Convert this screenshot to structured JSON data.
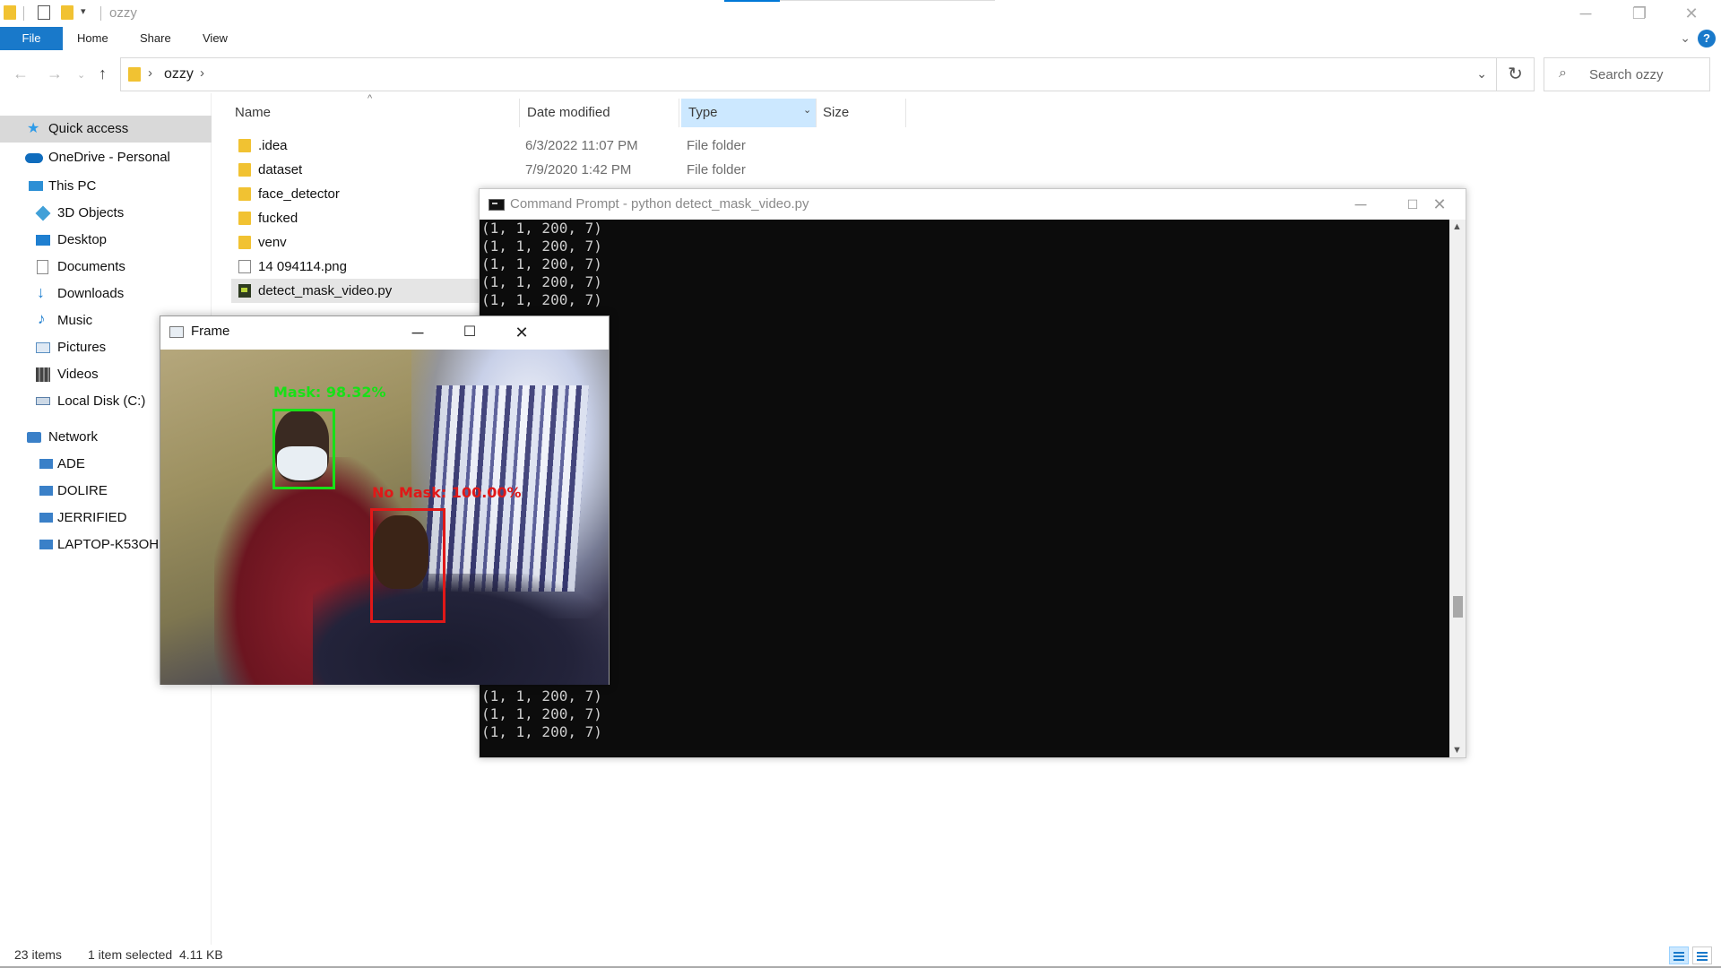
{
  "window": {
    "title": "ozzy",
    "minimize": "─",
    "maximize": "❐",
    "close": "✕"
  },
  "ribbon": {
    "tabs": [
      "File",
      "Home",
      "Share",
      "View"
    ],
    "help": "?"
  },
  "address": {
    "crumb": "ozzy",
    "search_placeholder": "Search ozzy"
  },
  "nav": {
    "items": [
      {
        "label": "Quick access",
        "icon": "star-icon",
        "color": "#2e9be8"
      },
      {
        "label": "OneDrive - Personal",
        "icon": "cloud-icon",
        "color": "#0f6cbd"
      },
      {
        "label": "This PC",
        "icon": "pc-icon",
        "color": "#2d8fd5"
      },
      {
        "label": "3D Objects",
        "icon": "cube-icon",
        "color": "#41a0d8"
      },
      {
        "label": "Desktop",
        "icon": "desktop-icon",
        "color": "#1f7fd0"
      },
      {
        "label": "Documents",
        "icon": "documents-icon",
        "color": "#8a8a8a"
      },
      {
        "label": "Downloads",
        "icon": "download-icon",
        "color": "#1f7fd0"
      },
      {
        "label": "Music",
        "icon": "music-icon",
        "color": "#1f7fd0"
      },
      {
        "label": "Pictures",
        "icon": "pictures-icon",
        "color": "#5a8fc2"
      },
      {
        "label": "Videos",
        "icon": "videos-icon",
        "color": "#444444"
      },
      {
        "label": "Local Disk (C:)",
        "icon": "disk-icon",
        "color": "#5a7fa8"
      },
      {
        "label": "Network",
        "icon": "network-icon",
        "color": "#3a80c8"
      },
      {
        "label": "ADE",
        "icon": "computer-icon",
        "color": "#3a80c8"
      },
      {
        "label": "DOLIRE",
        "icon": "computer-icon",
        "color": "#3a80c8"
      },
      {
        "label": "JERRIFIED",
        "icon": "computer-icon",
        "color": "#3a80c8"
      },
      {
        "label": "LAPTOP-K53OHP",
        "icon": "computer-icon",
        "color": "#3a80c8"
      }
    ]
  },
  "columns": {
    "name": "Name",
    "date": "Date modified",
    "type": "Type",
    "size": "Size"
  },
  "files": [
    {
      "name": ".idea",
      "date": "6/3/2022 11:07 PM",
      "type": "File folder",
      "kind": "folder"
    },
    {
      "name": "dataset",
      "date": "7/9/2020 1:42 PM",
      "type": "File folder",
      "kind": "folder"
    },
    {
      "name": "face_detector",
      "date": "",
      "type": "",
      "kind": "folder"
    },
    {
      "name": "fucked",
      "date": "",
      "type": "",
      "kind": "folder"
    },
    {
      "name": "venv",
      "date": "",
      "type": "",
      "kind": "folder"
    },
    {
      "name": "14 094114.png",
      "date": "",
      "type": "",
      "kind": "png"
    },
    {
      "name": "detect_mask_video.py",
      "date": "",
      "type": "",
      "kind": "py"
    }
  ],
  "cmd": {
    "title": "Command Prompt - python  detect_mask_video.py",
    "top_lines": [
      "(1, 1, 200, 7)",
      "(1, 1, 200, 7)",
      "(1, 1, 200, 7)",
      "(1, 1, 200, 7)",
      "(1, 1, 200, 7)"
    ],
    "bottom_lines": [
      "(1, 1, 200, 7)",
      "(1, 1, 200, 7)",
      "(1, 1, 200, 7)"
    ]
  },
  "frame": {
    "title": "Frame",
    "detections": [
      {
        "label": "Mask: 98.32%",
        "color": "#18e018"
      },
      {
        "label": "No Mask: 100.00%",
        "color": "#e01818"
      }
    ]
  },
  "status": {
    "items_count": "23 items",
    "selection": "1 item selected  4.11 KB"
  }
}
